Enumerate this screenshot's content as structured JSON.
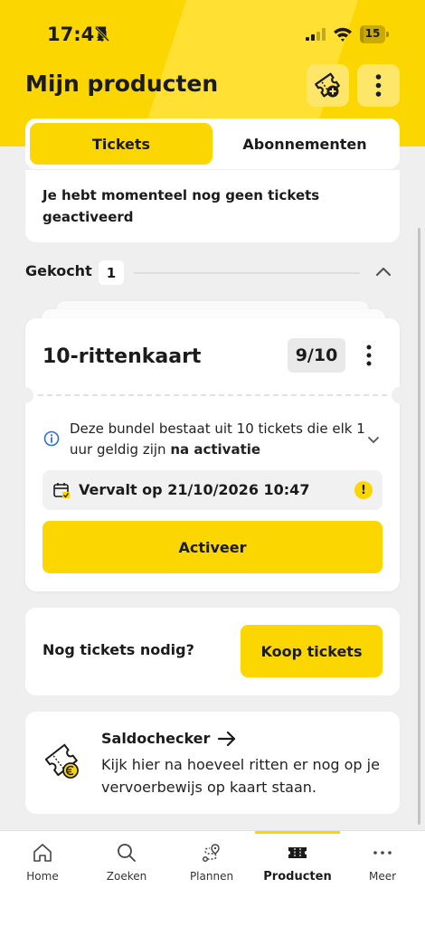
{
  "status_bar": {
    "time": "17:47",
    "battery": "15",
    "battery_level": 0.15
  },
  "header": {
    "title": "Mijn producten",
    "add_ticket_icon": "ticket-plus-icon",
    "menu_icon": "more-vertical-icon"
  },
  "tabs": [
    {
      "label": "Tickets",
      "active": true
    },
    {
      "label": "Abonnementen",
      "active": false
    }
  ],
  "notice": {
    "text": "Je hebt momenteel nog geen tickets geactiveerd"
  },
  "section": {
    "label": "Gekocht",
    "count": "1"
  },
  "ticket": {
    "title": "10-rittenkaart",
    "count": "9/10",
    "info_text": "Deze bundel bestaat uit 10 tickets die elk 1 uur geldig zijn ",
    "info_bold": "na activatie",
    "expiry": "Vervalt op 21/10/2026 10:47",
    "warning_glyph": "!",
    "activate_label": "Activeer"
  },
  "buy": {
    "question": "Nog tickets nodig?",
    "button": "Koop tickets"
  },
  "saldo": {
    "title": "Saldochecker",
    "description": "Kijk hier na hoeveel ritten er nog op je vervoerbewijs op kaart staan."
  },
  "nav": [
    {
      "label": "Home",
      "icon": "home-icon",
      "active": false
    },
    {
      "label": "Zoeken",
      "icon": "search-icon",
      "active": false
    },
    {
      "label": "Plannen",
      "icon": "route-icon",
      "active": false
    },
    {
      "label": "Producten",
      "icon": "ticket-icon",
      "active": true
    },
    {
      "label": "Meer",
      "icon": "more-horizontal-icon",
      "active": false
    }
  ],
  "colors": {
    "brand_yellow": "#fcd600",
    "background": "#efefef",
    "text": "#1b1b1b"
  }
}
